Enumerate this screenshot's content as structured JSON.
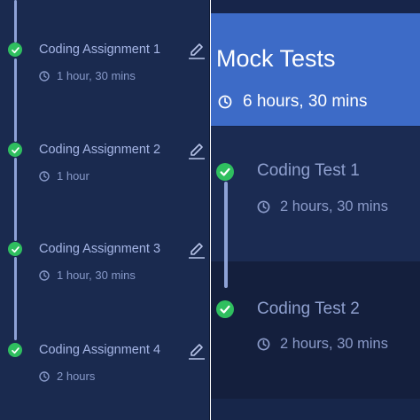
{
  "left": {
    "items": [
      {
        "title": "Coding Assignment 1",
        "duration": "1 hour, 30 mins"
      },
      {
        "title": "Coding Assignment 2",
        "duration": "1 hour"
      },
      {
        "title": "Coding Assignment 3",
        "duration": "1 hour, 30 mins"
      },
      {
        "title": "Coding Assignment 4",
        "duration": "2 hours"
      }
    ]
  },
  "right": {
    "header": {
      "title": "Mock Tests",
      "duration": "6 hours, 30 mins"
    },
    "items": [
      {
        "title": "Coding Test 1",
        "duration": "2 hours, 30 mins"
      },
      {
        "title": "Coding Test 2",
        "duration": "2 hours, 30 mins"
      }
    ]
  },
  "colors": {
    "left_bg": "#1a2a4f",
    "right_header_bg": "#3d6bc7",
    "check_green": "#2fbf5f",
    "timeline": "#8ea2d6"
  },
  "icons": [
    "check-circle-icon",
    "clock-icon",
    "edit-pencil-icon"
  ]
}
